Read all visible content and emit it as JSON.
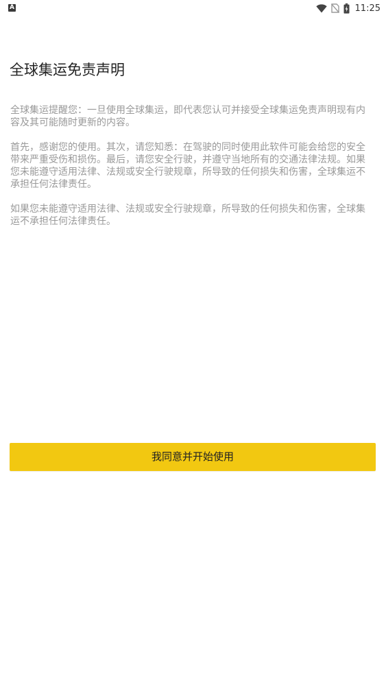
{
  "status_bar": {
    "time": "11:25",
    "left_icon": "notification-a-icon",
    "icons": [
      "wifi-icon",
      "no-sim-icon",
      "battery-charging-icon"
    ]
  },
  "disclaimer": {
    "title": "全球集运免责声明",
    "paragraphs": [
      "全球集运提醒您：一旦使用全球集运，即代表您认可并接受全球集运免责声明现有内容及其可能随时更新的内容。",
      "首先，感谢您的使用。其次，请您知悉：在驾驶的同时使用此软件可能会给您的安全带来严重受伤和损伤。最后，请您安全行驶，并遵守当地所有的交通法律法规。如果您未能遵守适用法律、法规或安全行驶规章，所导致的任何损失和伤害，全球集运不承担任何法律责任。",
      "如果您未能遵守适用法律、法规或安全行驶规章，所导致的任何损失和伤害，全球集运不承担任何法律责任。"
    ]
  },
  "agree_button": {
    "label": "我同意并开始使用"
  },
  "colors": {
    "accent": "#f2c811",
    "title_text": "#222222",
    "body_text": "#999999",
    "background": "#ffffff"
  }
}
